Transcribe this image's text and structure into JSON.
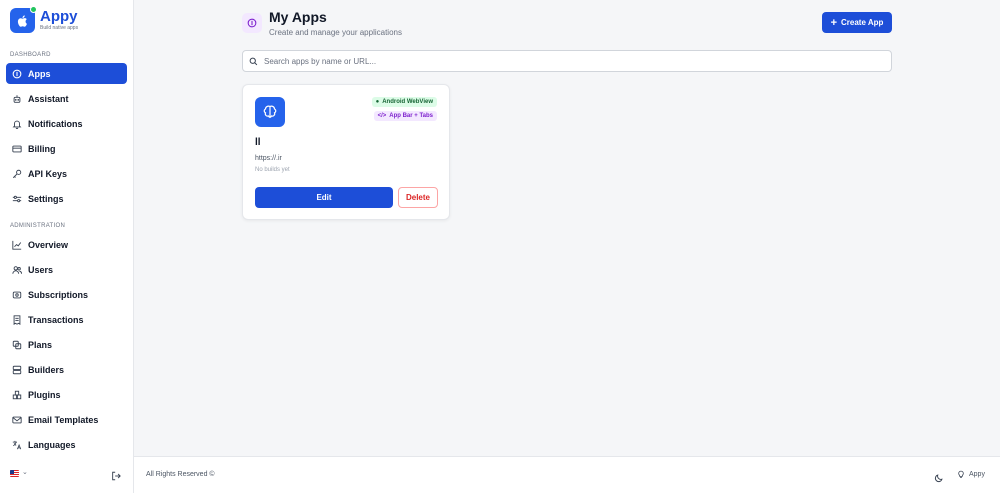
{
  "brand": {
    "name": "Appy",
    "tagline": "Build native apps"
  },
  "sidebar": {
    "dashboard_label": "DASHBOARD",
    "dashboard_items": [
      {
        "label": "Apps",
        "icon": "apps-icon",
        "active": true
      },
      {
        "label": "Assistant",
        "icon": "robot-icon"
      },
      {
        "label": "Notifications",
        "icon": "bell-icon"
      },
      {
        "label": "Billing",
        "icon": "credit-card-icon"
      },
      {
        "label": "API Keys",
        "icon": "key-icon"
      },
      {
        "label": "Settings",
        "icon": "sliders-icon"
      }
    ],
    "admin_label": "ADMINISTRATION",
    "admin_items": [
      {
        "label": "Overview",
        "icon": "chart-line-icon"
      },
      {
        "label": "Users",
        "icon": "users-icon"
      },
      {
        "label": "Subscriptions",
        "icon": "subscription-icon"
      },
      {
        "label": "Transactions",
        "icon": "receipt-icon"
      },
      {
        "label": "Plans",
        "icon": "layers-icon"
      },
      {
        "label": "Builders",
        "icon": "server-icon"
      },
      {
        "label": "Plugins",
        "icon": "puzzle-icon"
      },
      {
        "label": "Email Templates",
        "icon": "mail-icon"
      },
      {
        "label": "Languages",
        "icon": "translate-icon"
      }
    ],
    "language_selector": {
      "icon": "us-flag-icon"
    },
    "logout_icon": "logout-icon"
  },
  "header": {
    "title": "My Apps",
    "subtitle": "Create and manage your applications",
    "create_label": "Create App"
  },
  "search": {
    "placeholder": "Search apps by name or URL..."
  },
  "apps": [
    {
      "name": "ll",
      "url": "https://.ir",
      "builds": "No builds yet",
      "badges": [
        "Android WebView",
        "App Bar + Tabs"
      ],
      "edit_label": "Edit",
      "delete_label": "Delete"
    }
  ],
  "footer": {
    "text": "All Rights Reserved ©",
    "brand": "Appy"
  },
  "colors": {
    "primary": "#1d4ed8",
    "success": "#166534",
    "purple": "#7e22ce",
    "danger": "#dc2626"
  }
}
